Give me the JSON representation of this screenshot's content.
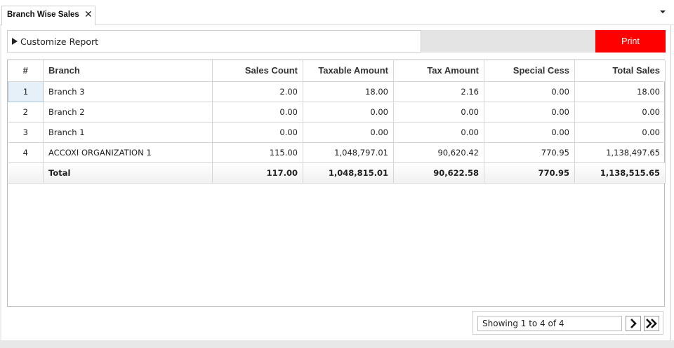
{
  "tab": {
    "title": "Branch Wise Sales",
    "close_glyph": "✕"
  },
  "toolbar": {
    "customize_label": "Customize Report",
    "print_label": "Print"
  },
  "colors": {
    "print_bg": "#ff0000",
    "selected_row": "#e6f0f8"
  },
  "table": {
    "columns": [
      "#",
      "Branch",
      "Sales Count",
      "Taxable Amount",
      "Tax Amount",
      "Special Cess",
      "Total Sales"
    ],
    "rows": [
      [
        "1",
        "Branch 3",
        "2.00",
        "18.00",
        "2.16",
        "0.00",
        "18.00"
      ],
      [
        "2",
        "Branch 2",
        "0.00",
        "0.00",
        "0.00",
        "0.00",
        "0.00"
      ],
      [
        "3",
        "Branch 1",
        "0.00",
        "0.00",
        "0.00",
        "0.00",
        "0.00"
      ],
      [
        "4",
        "ACCOXI ORGANIZATION 1",
        "115.00",
        "1,048,797.01",
        "90,620.42",
        "770.95",
        "1,138,497.65"
      ]
    ],
    "total": [
      "",
      "Total",
      "117.00",
      "1,048,815.01",
      "90,622.58",
      "770.95",
      "1,138,515.65"
    ]
  },
  "pager": {
    "status": "Showing 1 to 4 of 4",
    "next_icon": "chevron-right-icon",
    "last_icon": "double-chevron-right-icon"
  }
}
